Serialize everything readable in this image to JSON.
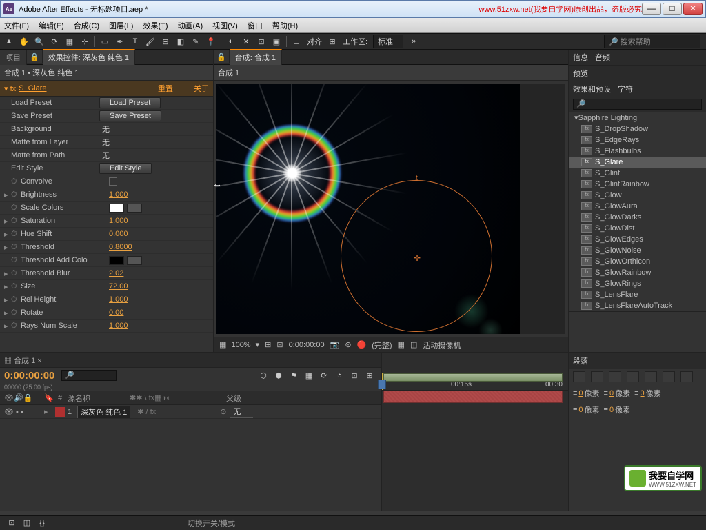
{
  "titlebar": {
    "app": "Adobe After Effects",
    "doc": "无标题项目.aep *",
    "watermark": "www.51zxw.net(我要自学网)原创出品，盗版必究",
    "icon_text": "Ae"
  },
  "menu": [
    "文件(F)",
    "编辑(E)",
    "合成(C)",
    "图层(L)",
    "效果(T)",
    "动画(A)",
    "视图(V)",
    "窗口",
    "帮助(H)"
  ],
  "toolbar": {
    "align": "对齐",
    "workarea_label": "工作区:",
    "workarea_value": "标准",
    "search_ph": "搜索帮助"
  },
  "left_tabs": {
    "project": "项目",
    "effects": "效果控件: 深灰色 纯色 1"
  },
  "effect": {
    "breadcrumb": "合成 1 • 深灰色 纯色 1",
    "name": "S_Glare",
    "reset": "重置",
    "about": "关于",
    "load_preset": "Load Preset",
    "load_preset_btn": "Load Preset",
    "save_preset": "Save Preset",
    "save_preset_btn": "Save Preset",
    "background": "Background",
    "none": "无",
    "matte_layer": "Matte from Layer",
    "matte_path": "Matte from Path",
    "edit_style": "Edit Style",
    "edit_style_btn": "Edit Style",
    "convolve": "Convolve",
    "brightness": "Brightness",
    "brightness_v": "1.000",
    "scale_colors": "Scale Colors",
    "saturation": "Saturation",
    "saturation_v": "1.000",
    "hue_shift": "Hue Shift",
    "hue_v": "0.000",
    "threshold": "Threshold",
    "threshold_v": "0.8000",
    "threshold_add": "Threshold Add Colo",
    "threshold_blur": "Threshold Blur",
    "threshold_blur_v": "2.02",
    "size": "Size",
    "size_v": "72.00",
    "rel_height": "Rel Height",
    "rel_height_v": "1.000",
    "rotate": "Rotate",
    "rotate_v": "0.00",
    "rays": "Rays Num Scale",
    "rays_v": "1.000"
  },
  "comp": {
    "tab": "合成: 合成 1",
    "name": "合成 1",
    "zoom": "100%",
    "time": "0:00:00:00",
    "res": "(完整)",
    "cam": "活动摄像机"
  },
  "right": {
    "info": "信息",
    "audio": "音频",
    "preview": "预览",
    "fxpreset": "效果和预设",
    "char": "字符",
    "group": "Sapphire Lighting",
    "items": [
      "S_DropShadow",
      "S_EdgeRays",
      "S_Flashbulbs",
      "S_Glare",
      "S_Glint",
      "S_GlintRainbow",
      "S_Glow",
      "S_GlowAura",
      "S_GlowDarks",
      "S_GlowDist",
      "S_GlowEdges",
      "S_GlowNoise",
      "S_GlowOrthicon",
      "S_GlowRainbow",
      "S_GlowRings",
      "S_LensFlare",
      "S_LensFlareAutoTrack"
    ],
    "selected": "S_Glare",
    "paragraph": "段落",
    "px": "像素",
    "zero": "0"
  },
  "timeline": {
    "tab": "合成 1",
    "timecode": "0:00:00:00",
    "fps": "00000 (25.00 fps)",
    "src_name": "源名称",
    "parent": "父级",
    "layer_num": "1",
    "layer_name": "深灰色 纯色 1",
    "none": "无",
    "t15": "00:15s",
    "t30": "00:30",
    "switch": "切换开关/模式"
  },
  "logo": {
    "text": "我要自学网",
    "url": "WWW.51ZXW.NET"
  }
}
